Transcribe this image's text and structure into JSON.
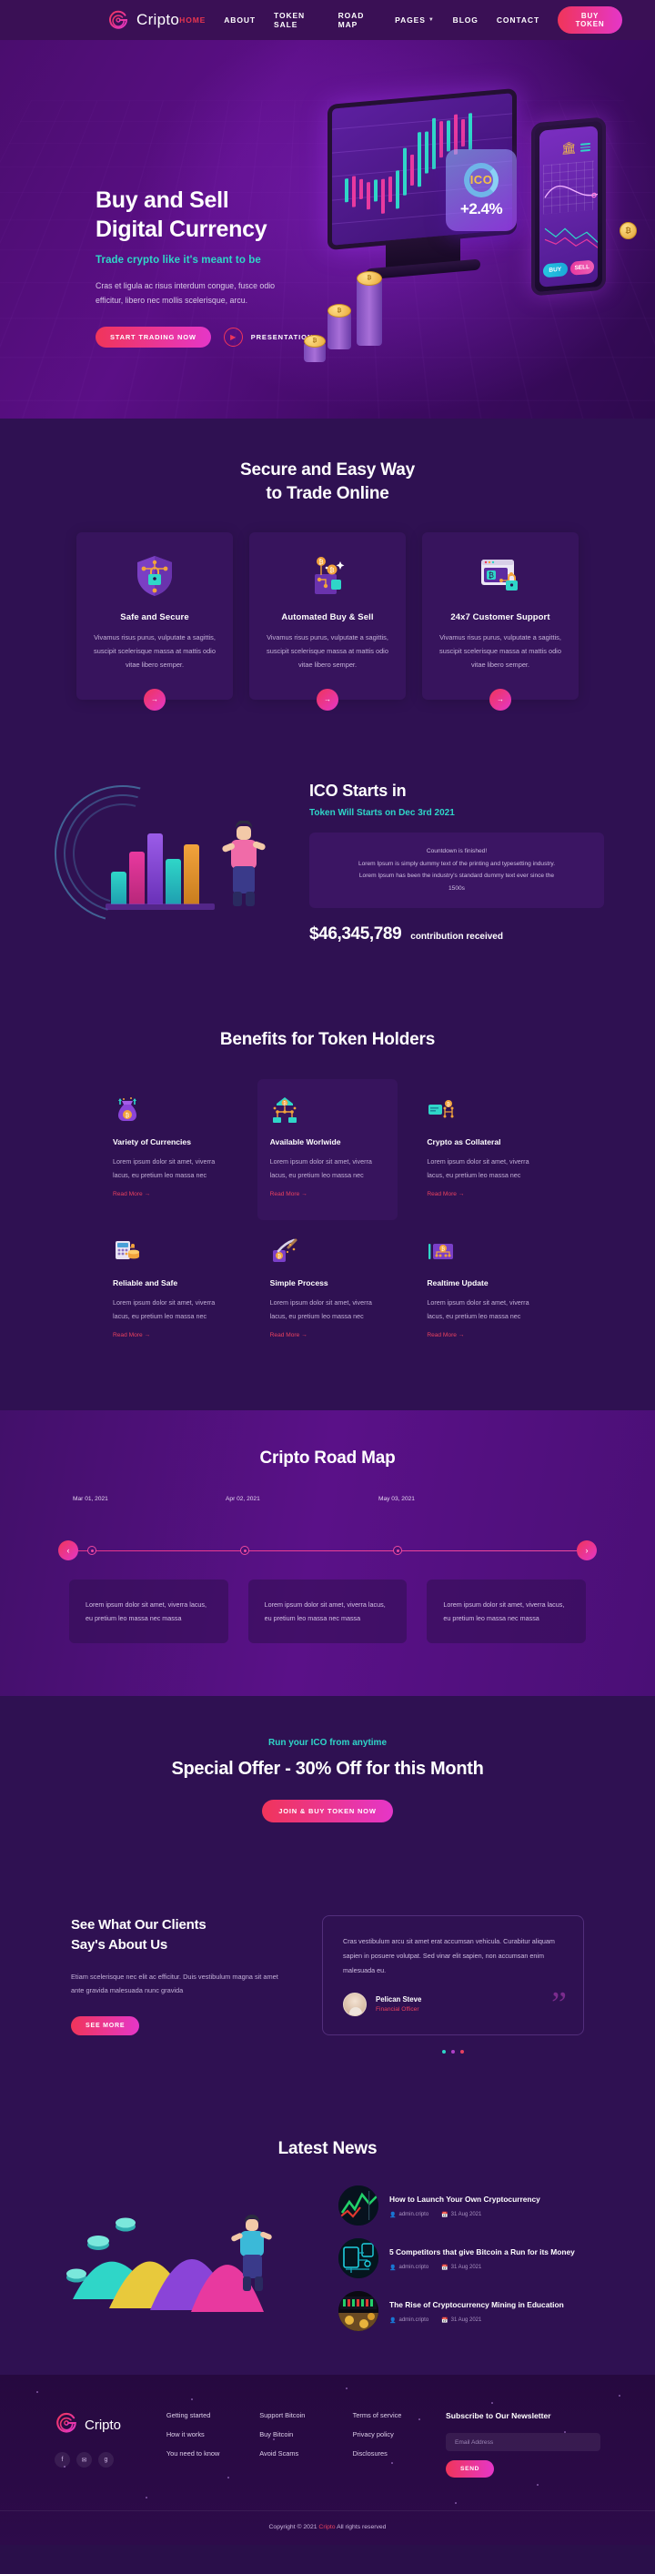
{
  "brand": {
    "name": "Cripto",
    "logo_icon": "spiral-c-logo-icon"
  },
  "nav": {
    "items": [
      {
        "label": "HOME",
        "active": true
      },
      {
        "label": "ABOUT",
        "active": false
      },
      {
        "label": "TOKEN SALE",
        "active": false
      },
      {
        "label": "ROAD MAP",
        "active": false
      },
      {
        "label": "PAGES",
        "active": false,
        "has_dropdown": true
      },
      {
        "label": "BLOG",
        "active": false
      },
      {
        "label": "CONTACT",
        "active": false
      }
    ],
    "cta_label": "BUY TOKEN"
  },
  "hero": {
    "title_line1": "Buy and Sell",
    "title_line2": "Digital Currency",
    "subtitle": "Trade crypto like it's meant to be",
    "paragraph": "Cras et ligula ac risus interdum congue, fusce odio efficitur, libero nec mollis scelerisque, arcu.",
    "primary_cta": "START TRADING NOW",
    "video_label": "PRESENTATION",
    "illustration": {
      "ico_badge": "ICO",
      "percent": "+2.4%",
      "buy_label": "BUY",
      "sell_label": "SELL"
    }
  },
  "features": {
    "title_line1": "Secure and Easy Way",
    "title_line2": "to Trade Online",
    "cards": [
      {
        "icon": "shield-lock-icon",
        "title": "Safe and Secure",
        "text": "Vivamus risus purus, vulputate a sagittis, suscipit scelerisque massa at mattis odio vitae libero semper."
      },
      {
        "icon": "bitcoin-exchange-icon",
        "title": "Automated Buy & Sell",
        "text": "Vivamus risus purus, vulputate a sagittis, suscipit scelerisque massa at mattis odio vitae libero semper."
      },
      {
        "icon": "browser-lock-icon",
        "title": "24x7 Customer Support",
        "text": "Vivamus risus purus, vulputate a sagittis, suscipit scelerisque massa at mattis odio vitae libero semper."
      }
    ]
  },
  "ico": {
    "title": "ICO Starts in",
    "date_line": "Token Will Starts on Dec 3rd 2021",
    "countdown_line1": "Countdown is finished!",
    "countdown_line2": "Lorem Ipsum is simply dummy text of the printing and typesetting industry.",
    "countdown_line3": "Lorem Ipsum has been the industry's standard dummy text ever since the",
    "countdown_line4": "1500s",
    "amount": "$46,345,789",
    "amount_label": "contribution received"
  },
  "benefits": {
    "title": "Benefits for Token Holders",
    "read_more": "Read More",
    "items": [
      {
        "icon": "money-bag-icon",
        "title": "Variety of Currencies",
        "text": "Lorem ipsum dolor sit amet, viverra lacus, eu pretium leo massa nec",
        "highlight": false
      },
      {
        "icon": "worldwide-network-icon",
        "title": "Available Worlwide",
        "text": "Lorem ipsum dolor sit amet, viverra lacus, eu pretium leo massa nec",
        "highlight": true
      },
      {
        "icon": "collateral-card-icon",
        "title": "Crypto as Collateral",
        "text": "Lorem ipsum dolor sit amet, viverra lacus, eu pretium leo massa nec",
        "highlight": false
      },
      {
        "icon": "calculator-coins-icon",
        "title": "Reliable and Safe",
        "text": "Lorem ipsum dolor sit amet, viverra lacus, eu pretium leo massa nec",
        "highlight": false
      },
      {
        "icon": "pickaxe-mining-icon",
        "title": "Simple Process",
        "text": "Lorem ipsum dolor sit amet, viverra lacus, eu pretium leo massa nec",
        "highlight": false
      },
      {
        "icon": "realtime-chart-icon",
        "title": "Realtime Update",
        "text": "Lorem ipsum dolor sit amet, viverra lacus, eu pretium leo massa nec",
        "highlight": false
      }
    ]
  },
  "roadmap": {
    "title": "Cripto Road Map",
    "prev_icon": "chevron-left-icon",
    "next_icon": "chevron-right-icon",
    "milestones": [
      {
        "date": "Mar 01, 2021",
        "text": "Lorem ipsum dolor sit amet, viverra lacus, eu pretium leo massa nec massa"
      },
      {
        "date": "Apr 02, 2021",
        "text": "Lorem ipsum dolor sit amet, viverra lacus, eu pretium leo massa nec massa"
      },
      {
        "date": "May 03, 2021",
        "text": "Lorem ipsum dolor sit amet, viverra lacus, eu pretium leo massa nec massa"
      }
    ]
  },
  "offer": {
    "kicker": "Run your ICO from anytime",
    "headline": "Special Offer - 30% Off for this Month",
    "cta": "JOIN & BUY TOKEN NOW"
  },
  "testimonials": {
    "title_line1": "See What Our Clients",
    "title_line2": "Say's About Us",
    "intro": "Etiam scelerisque nec elit ac efficitur. Duis vestibulum magna sit amet ante gravida malesuada nunc gravida",
    "cta": "SEE MORE",
    "quote": "Cras vestibulum arcu sit amet erat accumsan vehicula. Curabitur aliquam sapien in posuere volutpat. Sed vinar elit sapien, non accumsan enim malesuada eu.",
    "author_name": "Pelican Steve",
    "author_role": "Financial Officer",
    "quote_icon": "quotation-mark-icon"
  },
  "news": {
    "title": "Latest News",
    "items": [
      {
        "title": "How to Launch Your Own Cryptocurrency",
        "author": "admin.cripto",
        "date": "31 Aug 2021",
        "thumb": "stock-gauge-thumb"
      },
      {
        "title": "5 Competitors that give Bitcoin a Run for its Money",
        "author": "admin.cripto",
        "date": "31 Aug 2021",
        "thumb": "circuit-board-thumb"
      },
      {
        "title": "The Rise of Cryptocurrency Mining in Education",
        "author": "admin.cripto",
        "date": "31 Aug 2021",
        "thumb": "mining-rig-thumb"
      }
    ],
    "meta_icons": {
      "author": "user-icon",
      "date": "calendar-icon"
    }
  },
  "footer": {
    "brand": "Cripto",
    "social": [
      {
        "name": "facebook-icon",
        "glyph": "f"
      },
      {
        "name": "twitter-icon",
        "glyph": "✉"
      },
      {
        "name": "google-plus-icon",
        "glyph": "g"
      }
    ],
    "col1": [
      "Getting started",
      "How it works",
      "You need to know"
    ],
    "col2": [
      "Support Bitcoin",
      "Buy Bitcoin",
      "Avoid Scams"
    ],
    "col3": [
      "Terms of service",
      "Privacy policy",
      "Disclosures"
    ],
    "newsletter_title": "Subscribe to Our Newsletter",
    "email_placeholder": "Email Address",
    "send_label": "SEND",
    "copyright_prefix": "Copyright © 2021",
    "copyright_brand": "Cripto",
    "copyright_suffix": "All rights reserved"
  },
  "colors": {
    "accent_pink": "#e536c8",
    "accent_red": "#f0355a",
    "teal": "#2fd6c8",
    "bg_deep": "#2f1152",
    "card_bg": "#37145d"
  }
}
